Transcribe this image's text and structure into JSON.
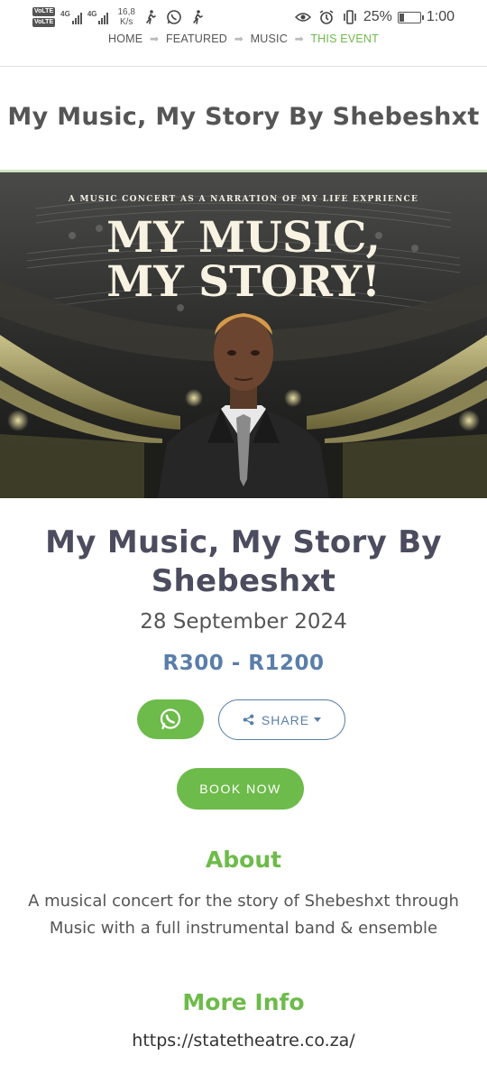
{
  "status_bar": {
    "volte1": "VoLTE",
    "volte2": "VoLTE",
    "net1": "4G",
    "net2": "4G",
    "speed_value": "16,8",
    "speed_unit": "K/s",
    "battery": "25%",
    "battery_level": 0.25,
    "time": "1:00"
  },
  "breadcrumb": {
    "items": [
      "HOME",
      "FEATURED",
      "MUSIC"
    ],
    "current": "THIS EVENT"
  },
  "page_heading": "My Music, My Story By Shebeshxt",
  "poster": {
    "tagline": "A MUSIC CONCERT AS A NARRATION OF MY LIFE EXPRIENCE",
    "line1": "MY MUSIC,",
    "line2": "MY STORY!"
  },
  "event": {
    "title": "My Music, My Story By Shebeshxt",
    "date": "28 September 2024",
    "price": "R300 - R1200"
  },
  "actions": {
    "share_label": "SHARE",
    "book_label": "BOOK NOW"
  },
  "about": {
    "heading": "About",
    "text": "A musical concert for the story of Shebeshxt through Music with a full instrumental band & ensemble"
  },
  "more_info": {
    "heading": "More Info",
    "link": "https://statetheatre.co.za/"
  },
  "colors": {
    "accent_green": "#6dbb4a",
    "price_blue": "#5a7ea9",
    "title_dark": "#4b4c5e"
  }
}
